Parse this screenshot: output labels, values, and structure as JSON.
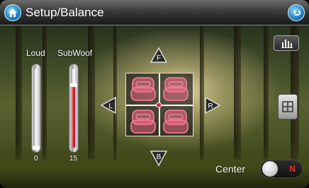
{
  "header": {
    "title": "Setup/Balance",
    "home_icon": "home-icon",
    "back_icon": "back-arrow-icon"
  },
  "sliders": {
    "loud": {
      "label": "Loud",
      "value": "0",
      "level_fraction": 0.0
    },
    "subwoof": {
      "label": "SubWoof",
      "value": "15",
      "level_fraction": 0.78
    }
  },
  "balance": {
    "front_label": "F",
    "back_label": "B",
    "left_label": "L",
    "right_label": "R"
  },
  "center": {
    "label": "Center",
    "state": "N"
  },
  "colors": {
    "accent_red": "#e2203c",
    "seat_pink": "#ff6f8f",
    "title_bar": "#3a3a3a"
  }
}
